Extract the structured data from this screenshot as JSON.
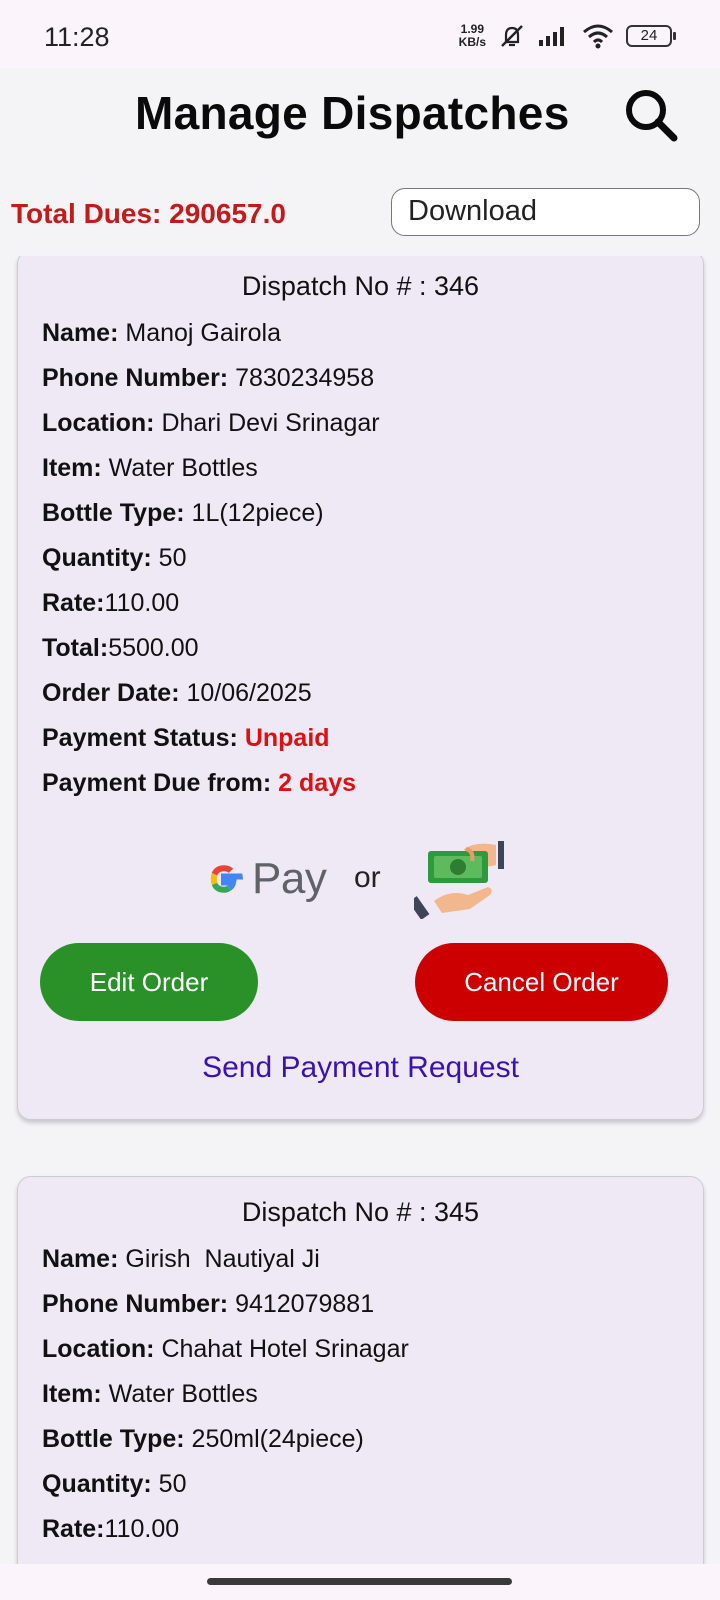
{
  "status_bar": {
    "time": "11:28",
    "net_speed_value": "1.99",
    "net_speed_unit": "KB/s",
    "battery": "24"
  },
  "header": {
    "title": "Manage Dispatches"
  },
  "summary": {
    "total_dues": "Total Dues: 290657.0",
    "download_label": "Download"
  },
  "labels": {
    "name": "Name:",
    "phone": "Phone Number:",
    "location": "Location:",
    "item": "Item:",
    "bottle_type": "Bottle Type:",
    "quantity": "Quantity:",
    "rate": "Rate:",
    "total": "Total:",
    "order_date": "Order Date:",
    "payment_status": "Payment Status:",
    "payment_due": "Payment Due from:"
  },
  "dispatches": [
    {
      "title": "Dispatch No # : 346",
      "name": " Manoj Gairola",
      "phone": " 7830234958",
      "location": " Dhari Devi Srinagar",
      "item": " Water Bottles",
      "bottle_type": " 1L(12piece)",
      "quantity": " 50",
      "rate": "110.00",
      "total": "5500.00",
      "order_date": " 10/06/2025",
      "payment_status": " Unpaid",
      "payment_due": " 2 days",
      "gpay_label": "Pay",
      "or_label": "or",
      "edit_label": "Edit Order",
      "cancel_label": "Cancel Order",
      "send_payment_label": "Send Payment Request"
    },
    {
      "title": "Dispatch No # : 345",
      "name": " Girish  Nautiyal Ji",
      "phone": " 9412079881",
      "location": " Chahat Hotel Srinagar",
      "item": " Water Bottles",
      "bottle_type": " 250ml(24piece)",
      "quantity": " 50",
      "rate": "110.00"
    }
  ],
  "colors": {
    "accent_red": "#cc0000",
    "edit_green": "#2a9128",
    "link_purple": "#3a11b5",
    "card_bg": "#efe9f6"
  },
  "icons": {
    "search": "search-icon",
    "cash": "cash-hand-icon",
    "gpay": "google-g-icon"
  }
}
